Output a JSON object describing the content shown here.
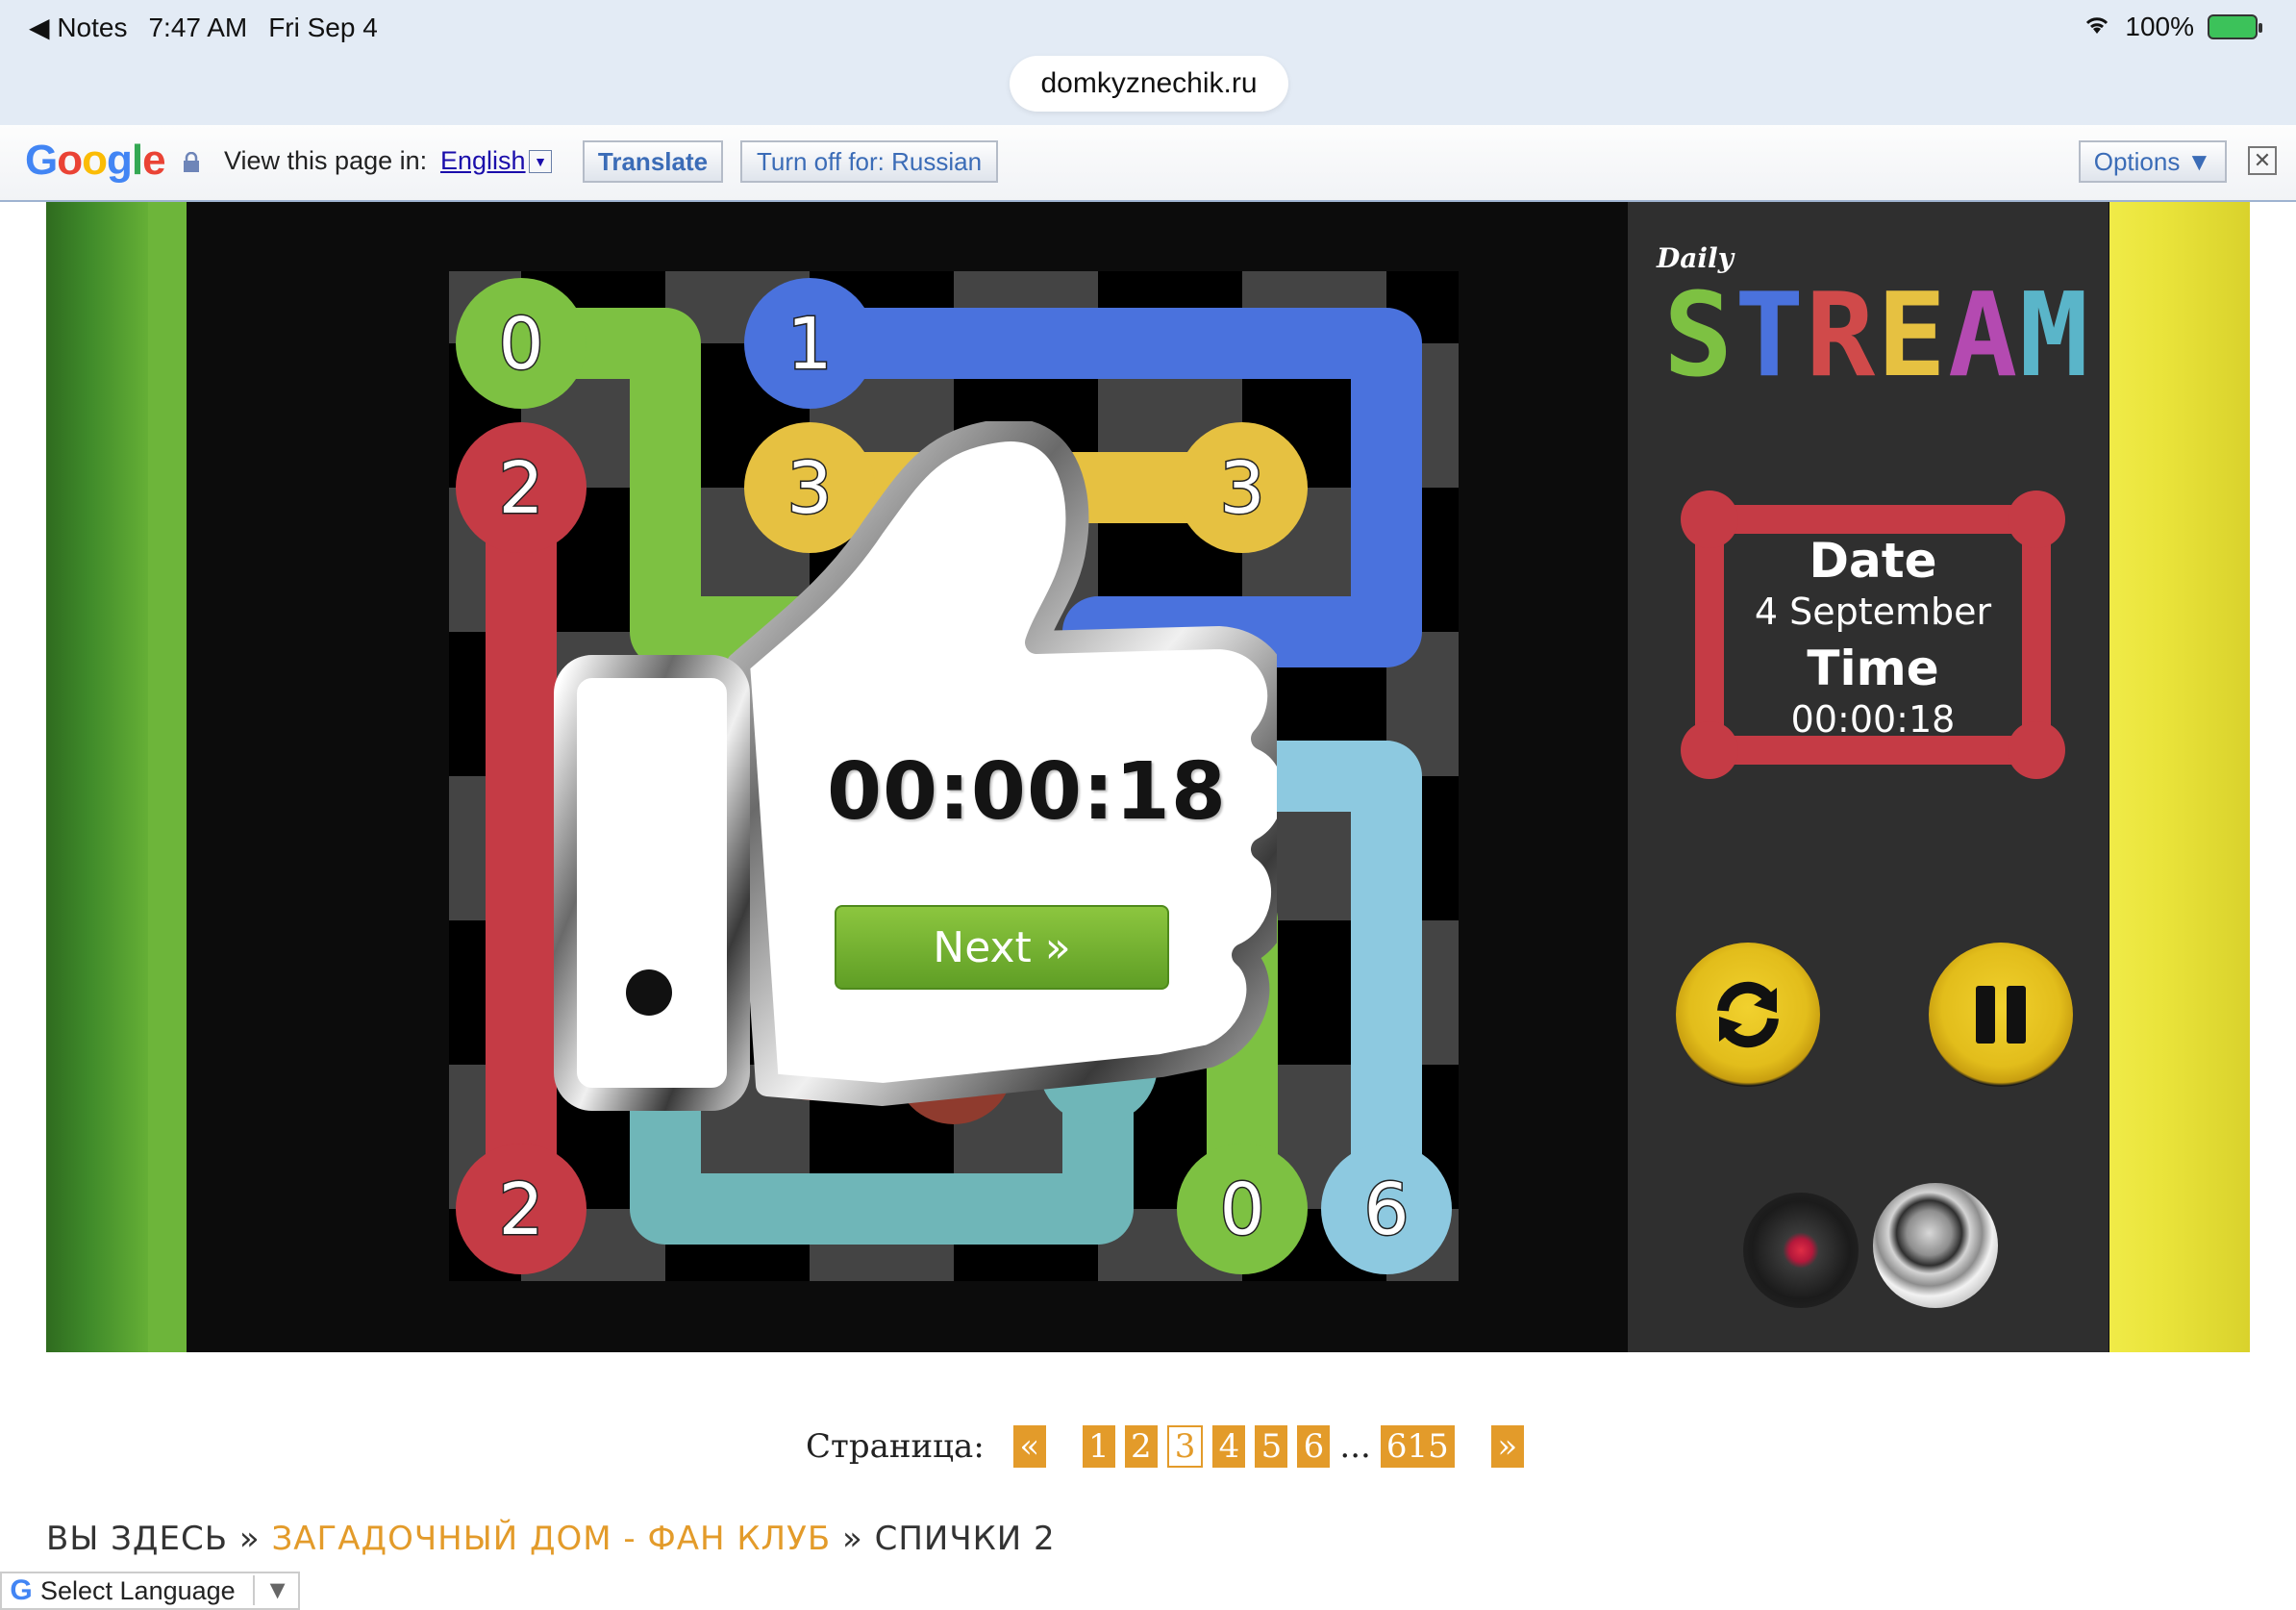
{
  "status_bar": {
    "back_app": "◀ Notes",
    "time": "7:47 AM",
    "date": "Fri Sep 4",
    "battery": "100%",
    "url": "domkyznechik.ru"
  },
  "translate_bar": {
    "prompt": "View this page in:",
    "language": "English",
    "translate_label": "Translate",
    "turn_off_label": "Turn off for: Russian",
    "options_label": "Options ▼"
  },
  "game": {
    "logo_small": "Daily",
    "logo_big": "STREAM",
    "logo_colors": [
      "#7dc142",
      "#4a72dd",
      "#d04a4a",
      "#e6c141",
      "#b44ab1",
      "#5ab5c9"
    ],
    "info": {
      "date_label": "Date",
      "date_value": "4 September",
      "time_label": "Time",
      "time_value": "00:00:18"
    },
    "popup": {
      "time": "00:00:18",
      "next_label": "Next »"
    },
    "colors": {
      "green": "#7dc142",
      "blue": "#4a72dd",
      "red": "#c53b45",
      "yellow": "#e6c141",
      "teal": "#6fb6b8",
      "lightblue": "#8dc9e0",
      "brown": "#8f3b2e"
    },
    "board_labels": {
      "green_top": "0",
      "blue_top": "1",
      "red_top": "2",
      "yellow_left": "3",
      "yellow_right": "3",
      "red_bottom": "2",
      "green_bottom": "0",
      "lightblue_bottom": "6"
    }
  },
  "pagination": {
    "label": "Страница:",
    "prev": "«",
    "pages": [
      "1",
      "2",
      "3",
      "4",
      "5",
      "6"
    ],
    "current": "3",
    "ellipsis": "...",
    "last": "615",
    "next": "»"
  },
  "breadcrumb": {
    "prefix": "ВЫ ЗДЕСЬ »",
    "link": "ЗАГАДОЧНЫЙ ДОМ - ФАН КЛУБ",
    "sep": "»",
    "current": "СПИЧКИ 2"
  },
  "language_select": {
    "label": "Select Language"
  }
}
